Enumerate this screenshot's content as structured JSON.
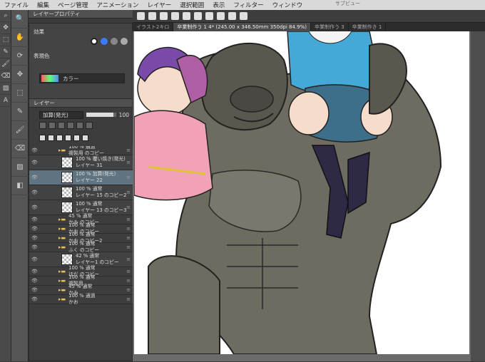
{
  "menu": [
    "ファイル",
    "編集",
    "ページ管理",
    "アニメーション",
    "レイヤー",
    "選択範囲",
    "表示",
    "フィルター",
    "ウィンドウ"
  ],
  "sub_view_title": "サブビュー",
  "property_panel": {
    "title": "レイヤープロパティ",
    "effect_label": "効果",
    "display_color_label": "表現色",
    "display_color_value": "カラー"
  },
  "layer_panel": {
    "title": "レイヤー",
    "blend_mode": "加算(発光)",
    "opacity": "100"
  },
  "tabs": [
    "イラスト2キロ",
    "卒業制作う 1 4* (245.00 x 346.50mm 350dpi 84.9%)",
    "卒業制作う 3",
    "卒業制作き 1"
  ],
  "layers": [
    {
      "type": "folder",
      "line1": "100 % 通過",
      "line2": "複製用 のコピー"
    },
    {
      "type": "layer",
      "line1": "100 % 覆い焼き(発光)",
      "line2": "レイヤー 31"
    },
    {
      "type": "layer",
      "selected": true,
      "line1": "100 % 加算(発光)",
      "line2": "レイヤー 22"
    },
    {
      "type": "layer",
      "line1": "100 % 通常",
      "line2": "レイヤー 15 のコピー2"
    },
    {
      "type": "layer",
      "line1": "100 % 通常",
      "line2": "レイヤー 13 のコピー3"
    },
    {
      "type": "folder",
      "line1": "45 % 通常",
      "line2": "かみ のコピー"
    },
    {
      "type": "folder",
      "line1": "100 % 通常",
      "line2": "かお のコピー"
    },
    {
      "type": "folder",
      "line1": "100 % 通常",
      "line2": "かお のコピー2"
    },
    {
      "type": "folder",
      "line1": "100 % 通常",
      "line2": "ふく のコピー"
    },
    {
      "type": "layer",
      "line1": "42 % 通常",
      "line2": "レイヤー1 のコピー"
    },
    {
      "type": "folder",
      "line1": "100 % 通常",
      "line2": "ほだ のコピー"
    },
    {
      "type": "folder",
      "line1": "100 % 通常",
      "line2": "複製用"
    },
    {
      "type": "folder",
      "line1": "45 % 通常",
      "line2": "かみ"
    },
    {
      "type": "folder",
      "line1": "100 % 通過",
      "line2": "かお"
    }
  ],
  "tool_icons": [
    "zoom-icon",
    "move-icon",
    "select-icon",
    "pen-icon",
    "brush-icon",
    "eraser-icon",
    "fill-icon",
    "text-icon"
  ]
}
